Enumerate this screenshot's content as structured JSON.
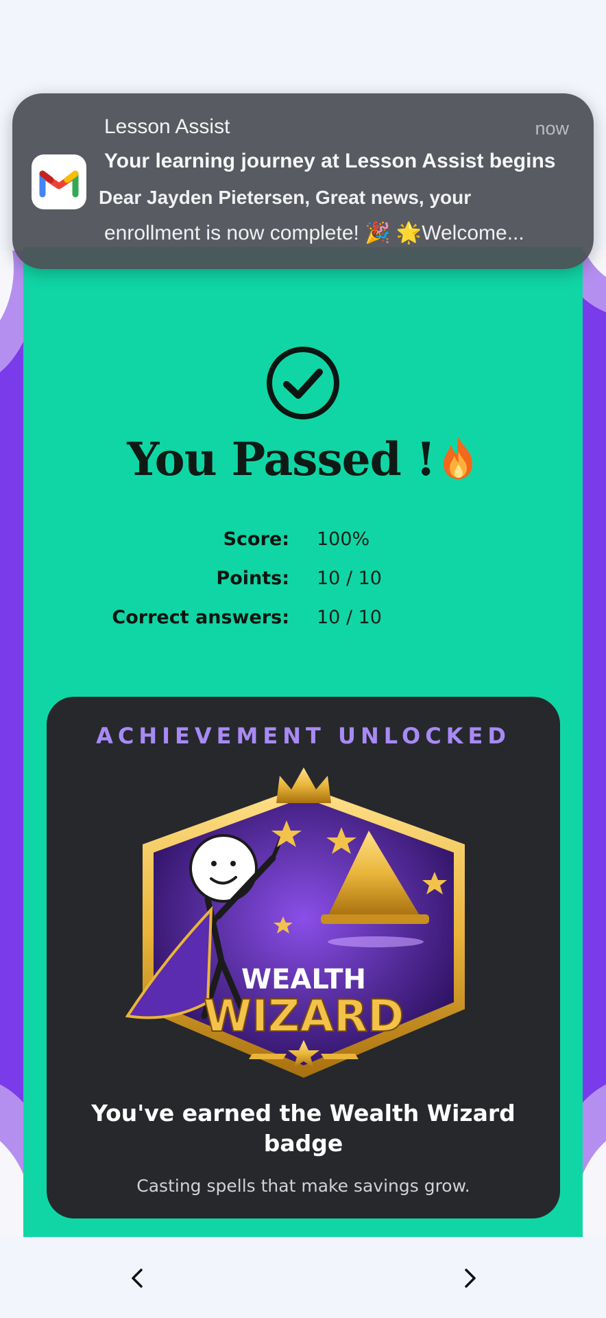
{
  "notification": {
    "app_name": "Lesson Assist",
    "time": "now",
    "subject": "Your learning journey at Lesson Assist begins",
    "body_line1": "Dear Jayden Pietersen, Great news, your",
    "body_line2": "enrollment is now complete! 🎉 🌟Welcome...",
    "icon": "gmail-icon"
  },
  "result": {
    "title": "You Passed !",
    "title_icon": "fire-icon",
    "stats": [
      {
        "label": "Score:",
        "value": "100%"
      },
      {
        "label": "Points:",
        "value": "10 / 10"
      },
      {
        "label": "Correct answers:",
        "value": "10 / 10"
      }
    ]
  },
  "achievement": {
    "heading": "ACHIEVEMENT UNLOCKED",
    "badge_line1": "WEALTH",
    "badge_line2": "WIZARD",
    "earned_text": "You've earned the Wealth Wizard badge",
    "description": "Casting spells that make savings grow."
  },
  "nav": {
    "back_icon": "chevron-left-icon",
    "forward_icon": "chevron-right-icon"
  },
  "colors": {
    "card_teal": "#10d6a5",
    "background_purple": "#7a3bea",
    "achievement_dark": "#26282c",
    "achievement_accent": "#a88af5",
    "badge_gold": "#e9b53a"
  }
}
